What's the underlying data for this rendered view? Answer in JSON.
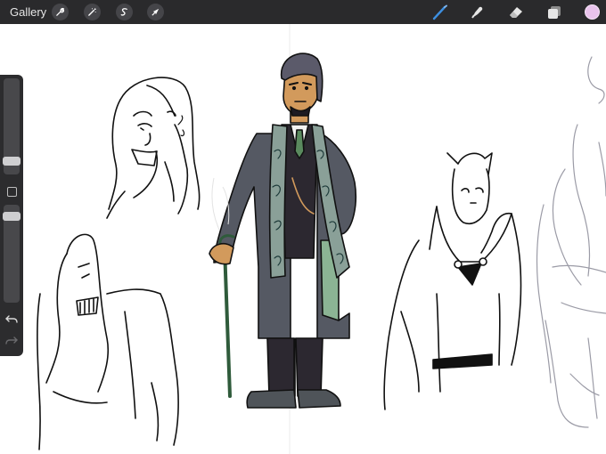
{
  "toolbar": {
    "gallery_label": "Gallery",
    "left_tools": [
      "wrench-icon",
      "magic-wand-icon",
      "selection-icon",
      "transform-arrow-icon"
    ],
    "right_tools": [
      "brush-icon",
      "smudge-icon",
      "eraser-icon",
      "layers-icon"
    ],
    "active_tool": "brush-icon",
    "active_tool_color": "#3d8fe0",
    "current_color": "#e9c3ec"
  },
  "sidebar": {
    "brush_size_level": 0.05,
    "opacity_level": 0.95,
    "controls": [
      "size-slider",
      "modify-button",
      "opacity-slider",
      "undo-icon",
      "redo-icon"
    ]
  },
  "canvas": {
    "content": "character-sketches",
    "colored_character_palette": [
      "#555963",
      "#2c2830",
      "#8bb494",
      "#d29a5c",
      "#8aa098"
    ]
  }
}
